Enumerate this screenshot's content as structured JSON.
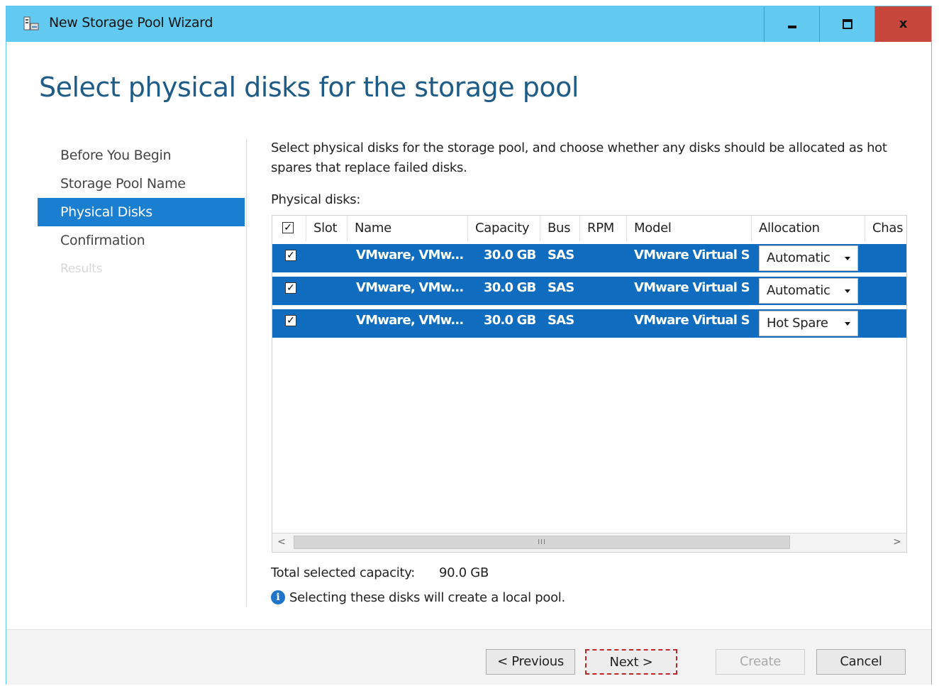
{
  "window": {
    "title": "New Storage Pool Wizard",
    "controls": {
      "minimize": "minimize",
      "maximize": "maximize",
      "close": "x"
    }
  },
  "page": {
    "title": "Select physical disks for the storage pool",
    "description": "Select physical disks for the storage pool, and choose whether any disks should be allocated as hot spares that replace failed disks.",
    "disks_label": "Physical disks:"
  },
  "nav": {
    "items": [
      {
        "label": "Before You Begin",
        "state": "normal"
      },
      {
        "label": "Storage Pool Name",
        "state": "normal"
      },
      {
        "label": "Physical Disks",
        "state": "active"
      },
      {
        "label": "Confirmation",
        "state": "normal"
      },
      {
        "label": "Results",
        "state": "disabled"
      }
    ]
  },
  "grid": {
    "columns": [
      "Slot",
      "Name",
      "Capacity",
      "Bus",
      "RPM",
      "Model",
      "Allocation",
      "Chas"
    ],
    "header_checked": true,
    "rows": [
      {
        "checked": true,
        "slot": "",
        "name": "VMware, VMw...",
        "capacity": "30.0 GB",
        "bus": "SAS",
        "rpm": "",
        "model": "VMware Virtual S",
        "allocation": "Automatic"
      },
      {
        "checked": true,
        "slot": "",
        "name": "VMware, VMw...",
        "capacity": "30.0 GB",
        "bus": "SAS",
        "rpm": "",
        "model": "VMware Virtual S",
        "allocation": "Automatic"
      },
      {
        "checked": true,
        "slot": "",
        "name": "VMware, VMw...",
        "capacity": "30.0 GB",
        "bus": "SAS",
        "rpm": "",
        "model": "VMware Virtual S",
        "allocation": "Hot Spare"
      }
    ],
    "scroll_thumb_label": "III"
  },
  "summary": {
    "total_label": "Total selected capacity:",
    "total_value": "90.0 GB",
    "info_text": "Selecting these disks will create a local pool."
  },
  "footer": {
    "previous": "< Previous",
    "next": "Next >",
    "create": "Create",
    "cancel": "Cancel"
  },
  "colors": {
    "titlebar": "#62caf0",
    "close_button": "#c8473c",
    "selection": "#0f6cbf",
    "nav_active": "#1a7fd0",
    "title_text": "#1e5b86"
  }
}
